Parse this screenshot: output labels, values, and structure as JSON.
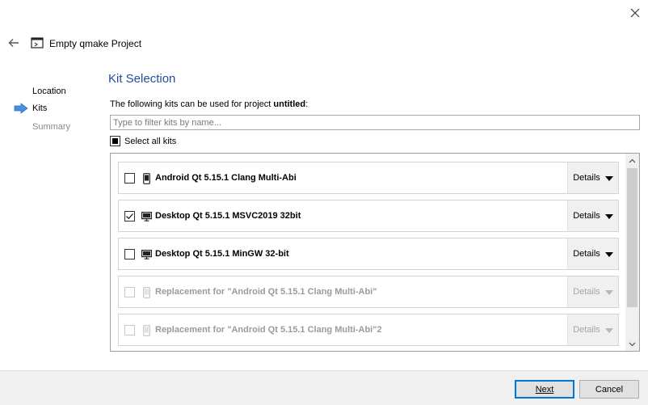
{
  "window": {
    "title": "Empty qmake Project",
    "close_icon": "close-icon",
    "back_icon": "back-arrow-icon"
  },
  "steps": [
    {
      "label": "Location"
    },
    {
      "label": "Kits"
    },
    {
      "label": "Summary"
    }
  ],
  "page": {
    "heading": "Kit Selection",
    "intro_prefix": "The following kits can be used for project ",
    "project_name": "untitled",
    "intro_suffix": ":",
    "filter_placeholder": "Type to filter kits by name...",
    "select_all_label": "Select all kits",
    "select_all_state": "partial"
  },
  "kits": [
    {
      "name": "Android Qt 5.15.1 Clang Multi-Abi",
      "checked": false,
      "enabled": true,
      "device_icon": "android-phone-icon",
      "details_label": "Details"
    },
    {
      "name": "Desktop Qt 5.15.1 MSVC2019 32bit",
      "checked": true,
      "enabled": true,
      "device_icon": "desktop-monitor-icon",
      "details_label": "Details"
    },
    {
      "name": "Desktop Qt 5.15.1 MinGW 32-bit",
      "checked": false,
      "enabled": true,
      "device_icon": "desktop-monitor-icon",
      "details_label": "Details"
    },
    {
      "name": "Replacement for \"Android Qt 5.15.1 Clang Multi-Abi\"",
      "checked": false,
      "enabled": false,
      "device_icon": "android-phone-icon",
      "details_label": "Details"
    },
    {
      "name": "Replacement for \"Android Qt 5.15.1 Clang Multi-Abi\"2",
      "checked": false,
      "enabled": false,
      "device_icon": "android-phone-icon",
      "details_label": "Details"
    }
  ],
  "footer": {
    "next_label": "Next",
    "cancel_label": "Cancel"
  },
  "colors": {
    "heading": "#1f4e9c",
    "current_step_arrow": "#4a8ee0",
    "default_button_border": "#0078d7"
  }
}
